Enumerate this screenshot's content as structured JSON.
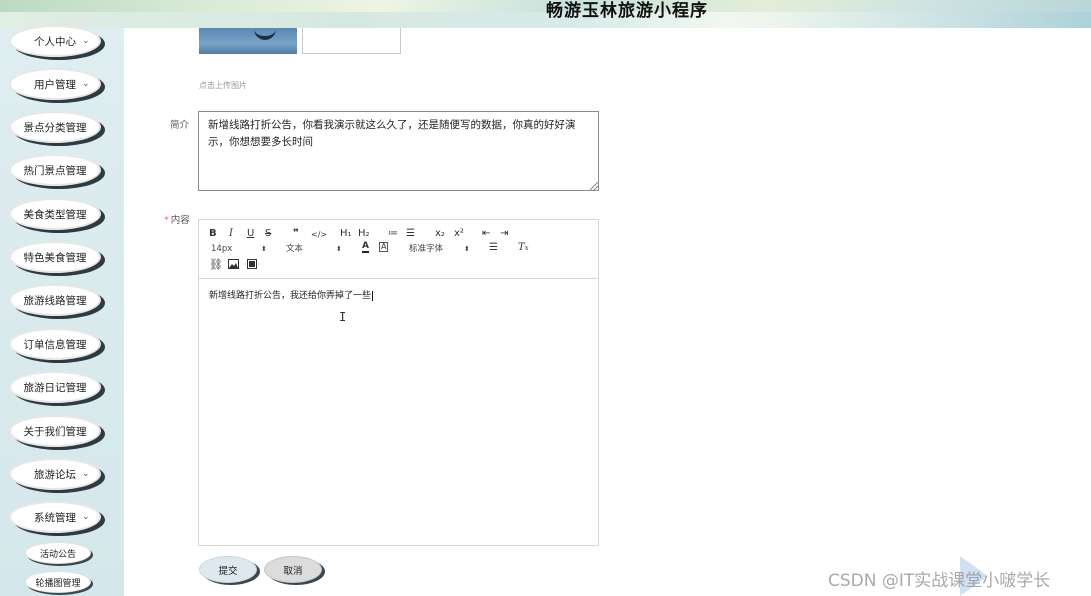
{
  "header": {
    "title": "畅游玉林旅游小程序"
  },
  "sidebar": {
    "items": [
      {
        "label": "个人中心",
        "has_chevron": true
      },
      {
        "label": "用户管理",
        "has_chevron": true
      },
      {
        "label": "景点分类管理",
        "has_chevron": false
      },
      {
        "label": "热门景点管理",
        "has_chevron": false
      },
      {
        "label": "美食类型管理",
        "has_chevron": false
      },
      {
        "label": "特色美食管理",
        "has_chevron": false
      },
      {
        "label": "旅游线路管理",
        "has_chevron": false
      },
      {
        "label": "订单信息管理",
        "has_chevron": false
      },
      {
        "label": "旅游日记管理",
        "has_chevron": false
      },
      {
        "label": "关于我们管理",
        "has_chevron": false
      },
      {
        "label": "旅游论坛",
        "has_chevron": true
      },
      {
        "label": "系统管理",
        "has_chevron": true
      }
    ],
    "sub_items": [
      {
        "label": "活动公告"
      },
      {
        "label": "轮播图管理"
      }
    ],
    "chevron_icon": "chevron-down-icon"
  },
  "form": {
    "upload_hint": "点击上传图片",
    "intro_label": "简介",
    "intro_value": "新增线路打折公告，你看我演示就这么久了，还是随便写的数据，你真的好好演示，你想想要多长时间",
    "content_required_mark": "*",
    "content_label": "内容",
    "content_value": "新增线路打折公告，我还给你弄掉了一些",
    "submit_label": "提交",
    "cancel_label": "取消"
  },
  "editor": {
    "toolbar_row1": [
      "B",
      "I",
      "U",
      "S",
      "❞",
      "</>",
      "H₁",
      "H₂",
      "≔",
      "☰",
      "x₂",
      "x²",
      "⇤",
      "⇥"
    ],
    "size_select": "14px",
    "type_select": "文本",
    "font_select": "标准字体",
    "icons": [
      "bold-icon",
      "italic-icon",
      "underline-icon",
      "strike-icon",
      "blockquote-icon",
      "code-icon",
      "h1-icon",
      "h2-icon",
      "ordered-list-icon",
      "bullet-list-icon",
      "subscript-icon",
      "superscript-icon",
      "outdent-icon",
      "indent-icon",
      "font-color-icon",
      "background-color-icon",
      "align-icon",
      "clear-format-icon",
      "link-icon",
      "image-icon",
      "video-icon"
    ]
  },
  "watermark": {
    "text": "CSDN @IT实战课堂小啵学长"
  }
}
